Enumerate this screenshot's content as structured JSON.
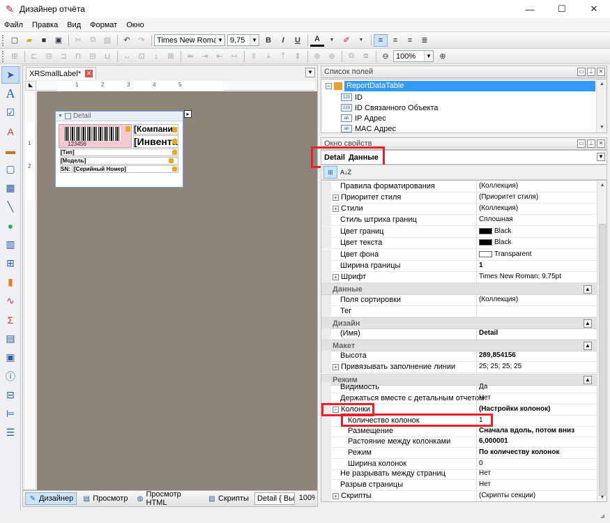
{
  "window": {
    "title": "Дизайнер отчёта",
    "minimize": "—",
    "maximize": "☐",
    "close": "✕"
  },
  "menu": [
    "Файл",
    "Правка",
    "Вид",
    "Формат",
    "Окно"
  ],
  "toolbar": {
    "font_name": "Times New Roman",
    "font_size": "9,75",
    "bold": "B",
    "italic": "I",
    "underline": "U",
    "zoom": "100%"
  },
  "designer": {
    "tab_title": "XRSmallLabel*",
    "ruler_marks": [
      "1",
      "2",
      "3",
      "4",
      "5"
    ],
    "ruler_v_marks": [
      "1",
      "2"
    ],
    "band_title": "Detail",
    "barcode_number": "123456",
    "label_company": "[Компания]",
    "label_inventory": "[Инвентар",
    "label_type": "[Тип]",
    "label_model": "[Модель]",
    "label_sn_caption": "SN:",
    "label_sn_value": "[Серийный Номер]"
  },
  "statusbar": {
    "designer": "Дизайнер",
    "preview": "Просмотр",
    "preview_html": "Просмотр HTML",
    "scripts": "Скрипты",
    "detail_field": "Detail { Высс",
    "zoom": "100%"
  },
  "field_list": {
    "title": "Список полей",
    "root": "ReportDataTable",
    "items": [
      {
        "icon": "123",
        "label": "ID"
      },
      {
        "icon": "123",
        "label": "ID Связанного Объекта"
      },
      {
        "icon": "ab",
        "label": "IP Адрес"
      },
      {
        "icon": "ab",
        "label": "MAC Адрес"
      }
    ]
  },
  "properties": {
    "title": "Окно свойств",
    "object_name": "Detail",
    "object_type": "Данные",
    "sort_label": "A↓Z"
  },
  "prop_rows": [
    {
      "name": "Правила форматирования",
      "value": "(Коллекция)"
    },
    {
      "name": "Приоритет стиля",
      "value": "(Приоритет стиля)",
      "expand": "+"
    },
    {
      "name": "Стили",
      "value": "(Коллекция)",
      "expand": "+"
    },
    {
      "name": "Стиль штриха границ",
      "value": "Сплошная"
    },
    {
      "name": "Цвет границ",
      "value": "Black",
      "swatch": "#000000"
    },
    {
      "name": "Цвет текста",
      "value": "Black",
      "swatch": "#000000"
    },
    {
      "name": "Цвет фона",
      "value": "Transparent",
      "swatch": "#ffffff"
    },
    {
      "name": "Ширина границы",
      "value": "1",
      "bold": true
    },
    {
      "name": "Шрифт",
      "value": "Times New Roman; 9,75pt",
      "expand": "+"
    },
    {
      "category": "Данные"
    },
    {
      "name": "Поля сортировки",
      "value": "(Коллекция)"
    },
    {
      "name": "Тег",
      "value": ""
    },
    {
      "category": "Дизайн"
    },
    {
      "name": "(Имя)",
      "value": "Detail",
      "bold": true
    },
    {
      "category": "Макет"
    },
    {
      "name": "Высота",
      "value": "289,854156",
      "bold": true
    },
    {
      "name": "Привязывать заполнение линии",
      "value": "25; 25; 25; 25",
      "expand": "+"
    },
    {
      "category": "Режим"
    },
    {
      "name": "Видимость",
      "value": "Да"
    },
    {
      "name": "Держаться вместе с детальным отчетом",
      "value": "Нет"
    },
    {
      "name": "Колонки",
      "value": "(Настройки колонок)",
      "bold": true,
      "expand": "−"
    },
    {
      "name": "Количество колонок",
      "value": "1",
      "indent": true
    },
    {
      "name": "Размещение",
      "value": "Сначала вдоль, потом вниз",
      "bold": true,
      "indent": true
    },
    {
      "name": "Растояние между колонками",
      "value": "6,000001",
      "bold": true,
      "indent": true
    },
    {
      "name": "Режим",
      "value": "По количеству колонок",
      "bold": true,
      "indent": true
    },
    {
      "name": "Ширина колонок",
      "value": "0",
      "indent": true
    },
    {
      "name": "Не разрывать между страниц",
      "value": "Нет"
    },
    {
      "name": "Разрыв страницы",
      "value": "Нет"
    },
    {
      "name": "Скрипты",
      "value": "(Скрипты секции)",
      "expand": "+"
    }
  ],
  "colors": {
    "highlight": "#e8202a",
    "selection": "#3399ff",
    "canvas": "#8c8379",
    "barcode_bg": "#f7c9d2"
  }
}
